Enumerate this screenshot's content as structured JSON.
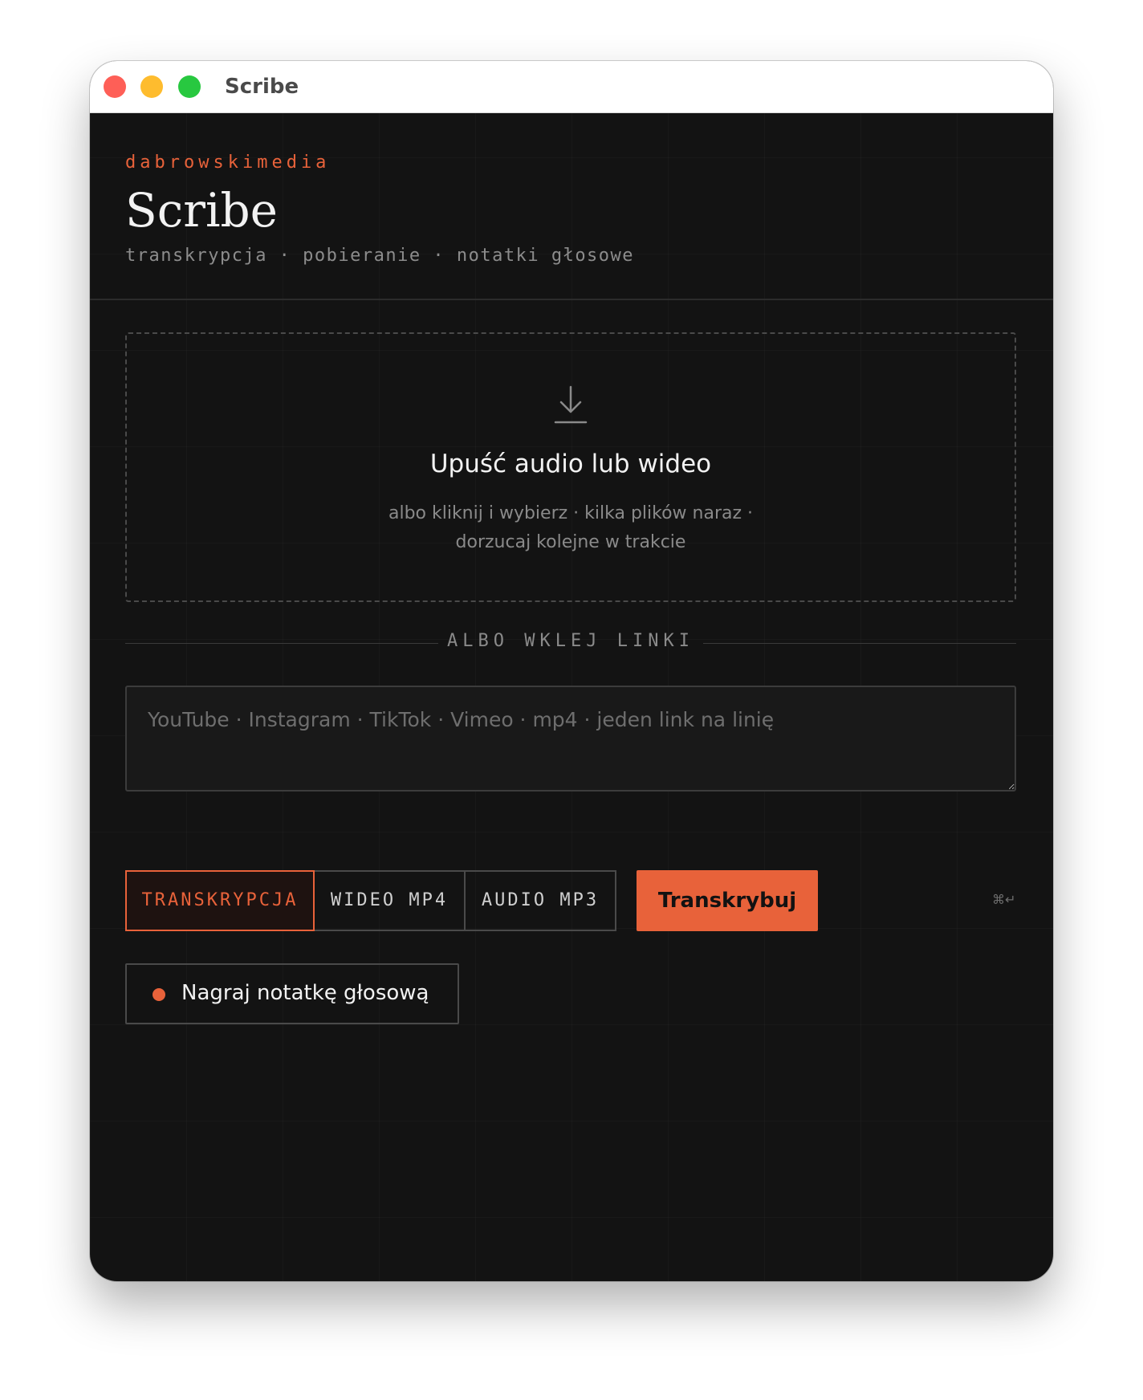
{
  "window": {
    "title": "Scribe"
  },
  "header": {
    "brand": "dabrowskimedia",
    "app_name": "Scribe",
    "tagline": "transkrypcja · pobieranie · notatki głosowe"
  },
  "dropzone": {
    "icon": "download-arrow-icon",
    "title": "Upuść audio lub wideo",
    "subtitle_line1": "albo kliknij i wybierz · kilka plików naraz ·",
    "subtitle_line2": "dorzucaj kolejne w trakcie"
  },
  "divider": {
    "label": "ALBO WKLEJ LINKI"
  },
  "links": {
    "value": "",
    "placeholder": "YouTube · Instagram · TikTok · Vimeo · mp4 · jeden link na linię"
  },
  "modes": {
    "selected": "TRANSKRYPCJA",
    "options": [
      {
        "label": "TRANSKRYPCJA"
      },
      {
        "label": "WIDEO MP4"
      },
      {
        "label": "AUDIO MP3"
      }
    ]
  },
  "actions": {
    "transcribe_label": "Transkrybuj",
    "shortcut": "⌘↵",
    "record_label": "Nagraj notatkę głosową"
  },
  "colors": {
    "accent": "#e8623a",
    "background": "#131313",
    "text": "#f2f2f2",
    "muted": "#8a8a8a"
  }
}
